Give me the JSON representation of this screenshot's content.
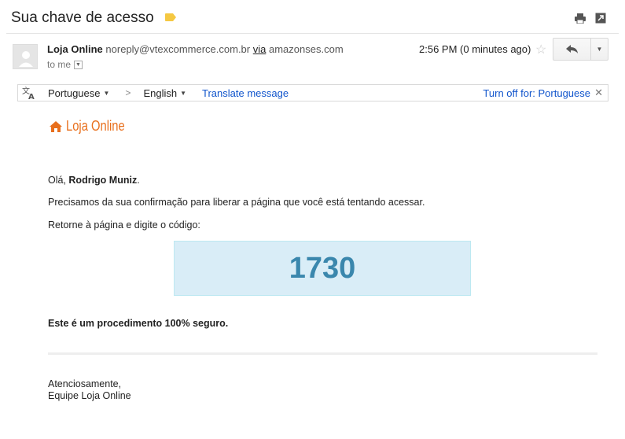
{
  "header": {
    "subject": "Sua chave de acesso",
    "label_color": "#f5c842"
  },
  "message": {
    "sender_name": "Loja Online",
    "sender_email": "noreply@vtexcommerce.com.br",
    "via_label": "via",
    "via_domain": "amazonses.com",
    "to_label": "to me",
    "timestamp": "2:56 PM (0 minutes ago)"
  },
  "translate": {
    "source_lang": "Portuguese",
    "target_lang": "English",
    "translate_link": "Translate message",
    "turn_off_link": "Turn off for: Portuguese"
  },
  "body": {
    "brand": "Loja Online",
    "brand_color": "#e86f1c",
    "greeting_prefix": "Olá, ",
    "greeting_name": "Rodrigo Muniz",
    "greeting_suffix": ".",
    "line1": "Precisamos da sua confirmação para liberar a página que você está tentando acessar.",
    "line2": "Retorne à página e digite o código:",
    "code": "1730",
    "safe_note": "Este é um procedimento 100% seguro.",
    "signoff_1": "Atenciosamente,",
    "signoff_2": "Equipe Loja Online"
  },
  "icons": {
    "label": "label-tag-icon",
    "print": "print-icon",
    "popout": "new-window-icon",
    "star": "star-icon",
    "reply": "reply-icon",
    "more": "chevron-down-icon",
    "translate": "translate-icon",
    "close": "close-icon",
    "home": "home-icon"
  }
}
